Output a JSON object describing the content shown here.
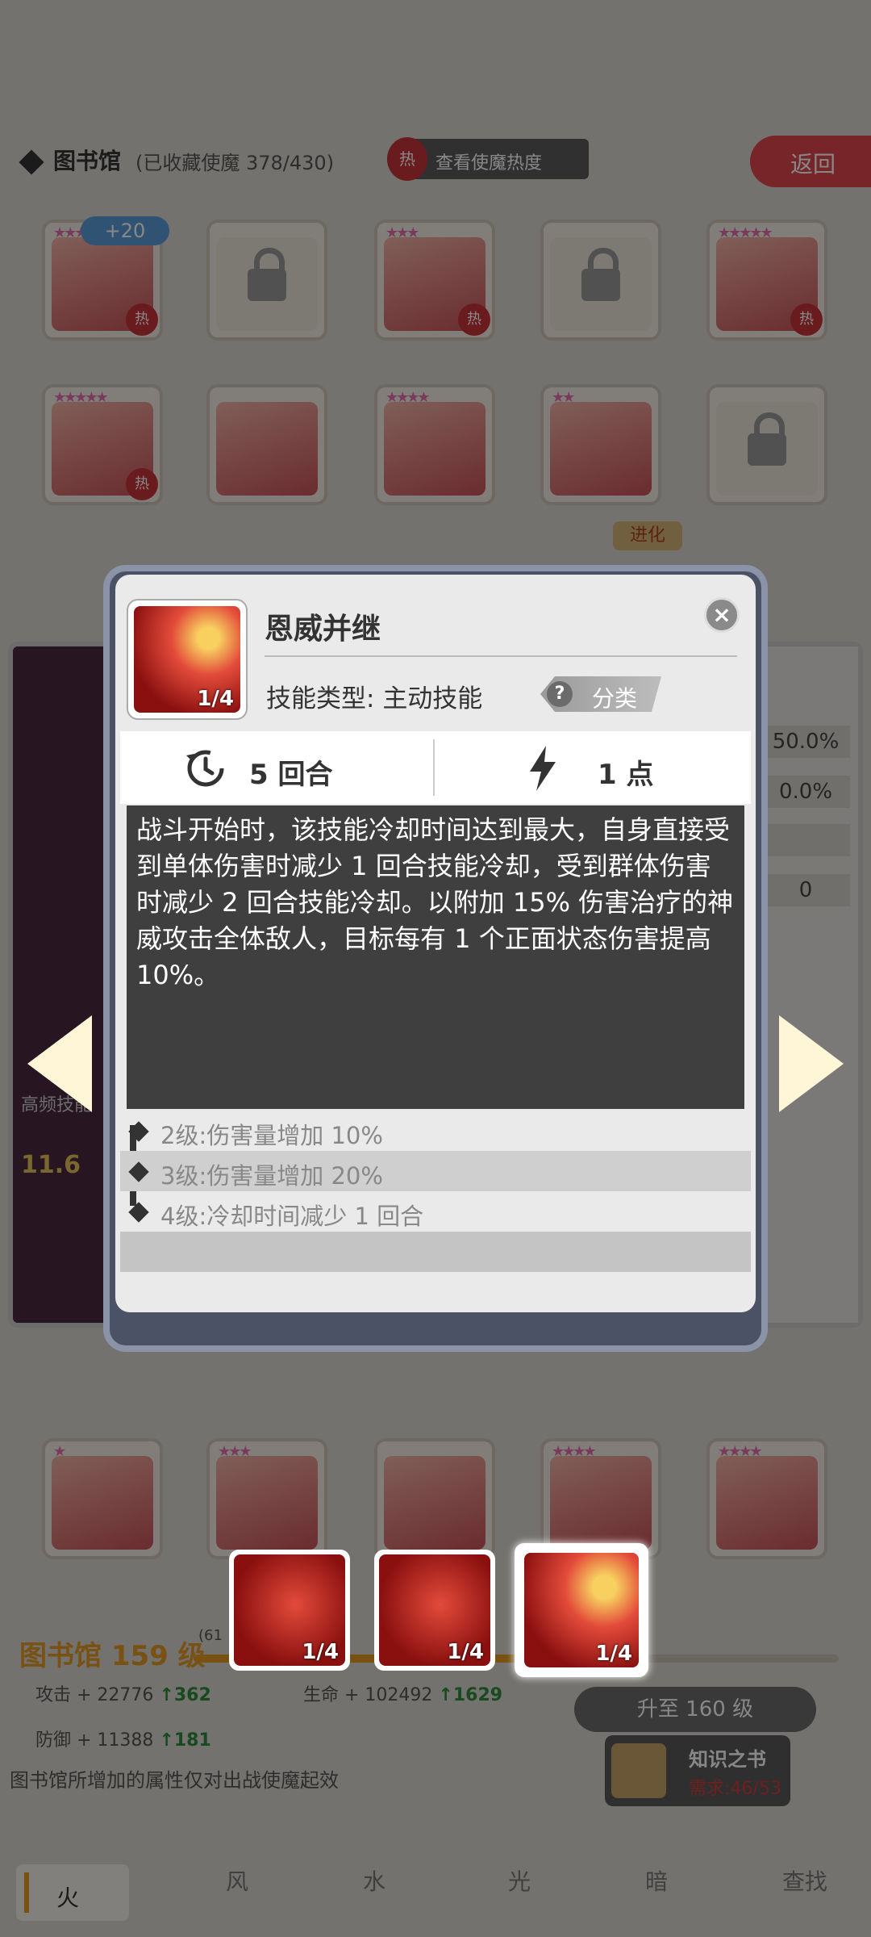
{
  "header": {
    "title": "图书馆",
    "collection": "(已收藏使魔 378/430)",
    "heat_label": "查看使魔热度",
    "heat_flame": "热",
    "back_label": "返回"
  },
  "grid": {
    "badge": "+20",
    "hot_label": "热",
    "evolve_label": "进化"
  },
  "back_panel": {
    "right_values": [
      "50.0%",
      "0.0%",
      "",
      "0"
    ],
    "left_label": "高频技能",
    "left_value": "11.6"
  },
  "modal": {
    "skill_name": "恩威并继",
    "skill_level": "1/4",
    "type_label": "技能类型:",
    "type_value": "主动技能",
    "category_label": "分类",
    "category_icon": "?",
    "close_label": "×",
    "cooldown": "5 回合",
    "cost": "1 点",
    "description": "战斗开始时，该技能冷却时间达到最大，自身直接受到单体伤害时减少 1 回合技能冷却，受到群体伤害时减少 2 回合技能冷却。以附加 15% 伤害治疗的神威攻击全体敌人，目标每有 1 个正面状态伤害提高 10%。",
    "levels": [
      {
        "label": "2级:",
        "text": "伤害量增加 10%"
      },
      {
        "label": "3级:",
        "text": "伤害量增加 20%"
      },
      {
        "label": "4级:",
        "text": "冷却时间减少 1 回合"
      }
    ]
  },
  "skill_bar": [
    {
      "level": "1/4",
      "active": false
    },
    {
      "level": "1/4",
      "active": false
    },
    {
      "level": "1/4",
      "active": true
    }
  ],
  "library": {
    "level": "图书馆 159 级",
    "progress_prefix": "(61",
    "progress_fraction": 0.62,
    "atk_label": "攻击 + 22776",
    "atk_up": "↑362",
    "hp_label": "生命 + 102492",
    "hp_up": "↑1629",
    "def_label": "防御 + 11388",
    "def_up": "↑181",
    "upgrade_label": "升至 160 级",
    "book_title": "知识之书",
    "book_need": "需求:46/53",
    "note": "图书馆所增加的属性仅对出战使魔起效"
  },
  "tabs": [
    "火",
    "风",
    "水",
    "光",
    "暗",
    "查找"
  ],
  "colors": {
    "accent_orange": "#e39a24",
    "hot_red": "#c8343a",
    "back_red": "#e0474d",
    "stat_green": "#2e8b3c"
  }
}
